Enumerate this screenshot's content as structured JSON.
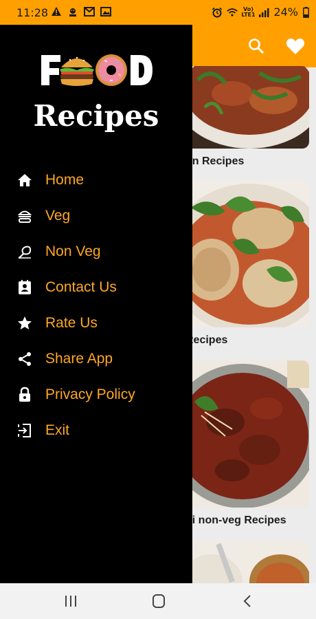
{
  "status_bar": {
    "time": "11:28",
    "battery": "24%",
    "notification_icons": [
      "warning-icon",
      "usb-debug-icon",
      "gmail-icon",
      "image-icon"
    ],
    "system_icons": [
      "alarm-icon",
      "wifi-icon",
      "volte-icon",
      "signal-icon",
      "battery-icon"
    ]
  },
  "app_bar": {
    "background": "#FFA000",
    "icons": [
      "search-icon",
      "heart-icon"
    ]
  },
  "drawer": {
    "logo_text": "FOOD",
    "logo_subtitle": "Recipes",
    "background": "#000000",
    "label_color": "#FFA726",
    "items": [
      {
        "label": "Home",
        "icon": "home-icon"
      },
      {
        "label": "Veg",
        "icon": "burger-icon"
      },
      {
        "label": "Non Veg",
        "icon": "chicken-leg-icon"
      },
      {
        "label": "Contact Us",
        "icon": "contact-icon"
      },
      {
        "label": "Rate Us",
        "icon": "star-icon"
      },
      {
        "label": "Share App",
        "icon": "share-icon"
      },
      {
        "label": "Privacy Policy",
        "icon": "lock-icon"
      },
      {
        "label": "Exit",
        "icon": "exit-icon"
      }
    ]
  },
  "content": {
    "cards": [
      {
        "title": "on Recipes"
      },
      {
        "title": "Recipes"
      },
      {
        "title": "bi non-veg Recipes"
      }
    ]
  },
  "nav_bar": {
    "buttons": [
      "recents-button",
      "home-button",
      "back-button"
    ]
  }
}
